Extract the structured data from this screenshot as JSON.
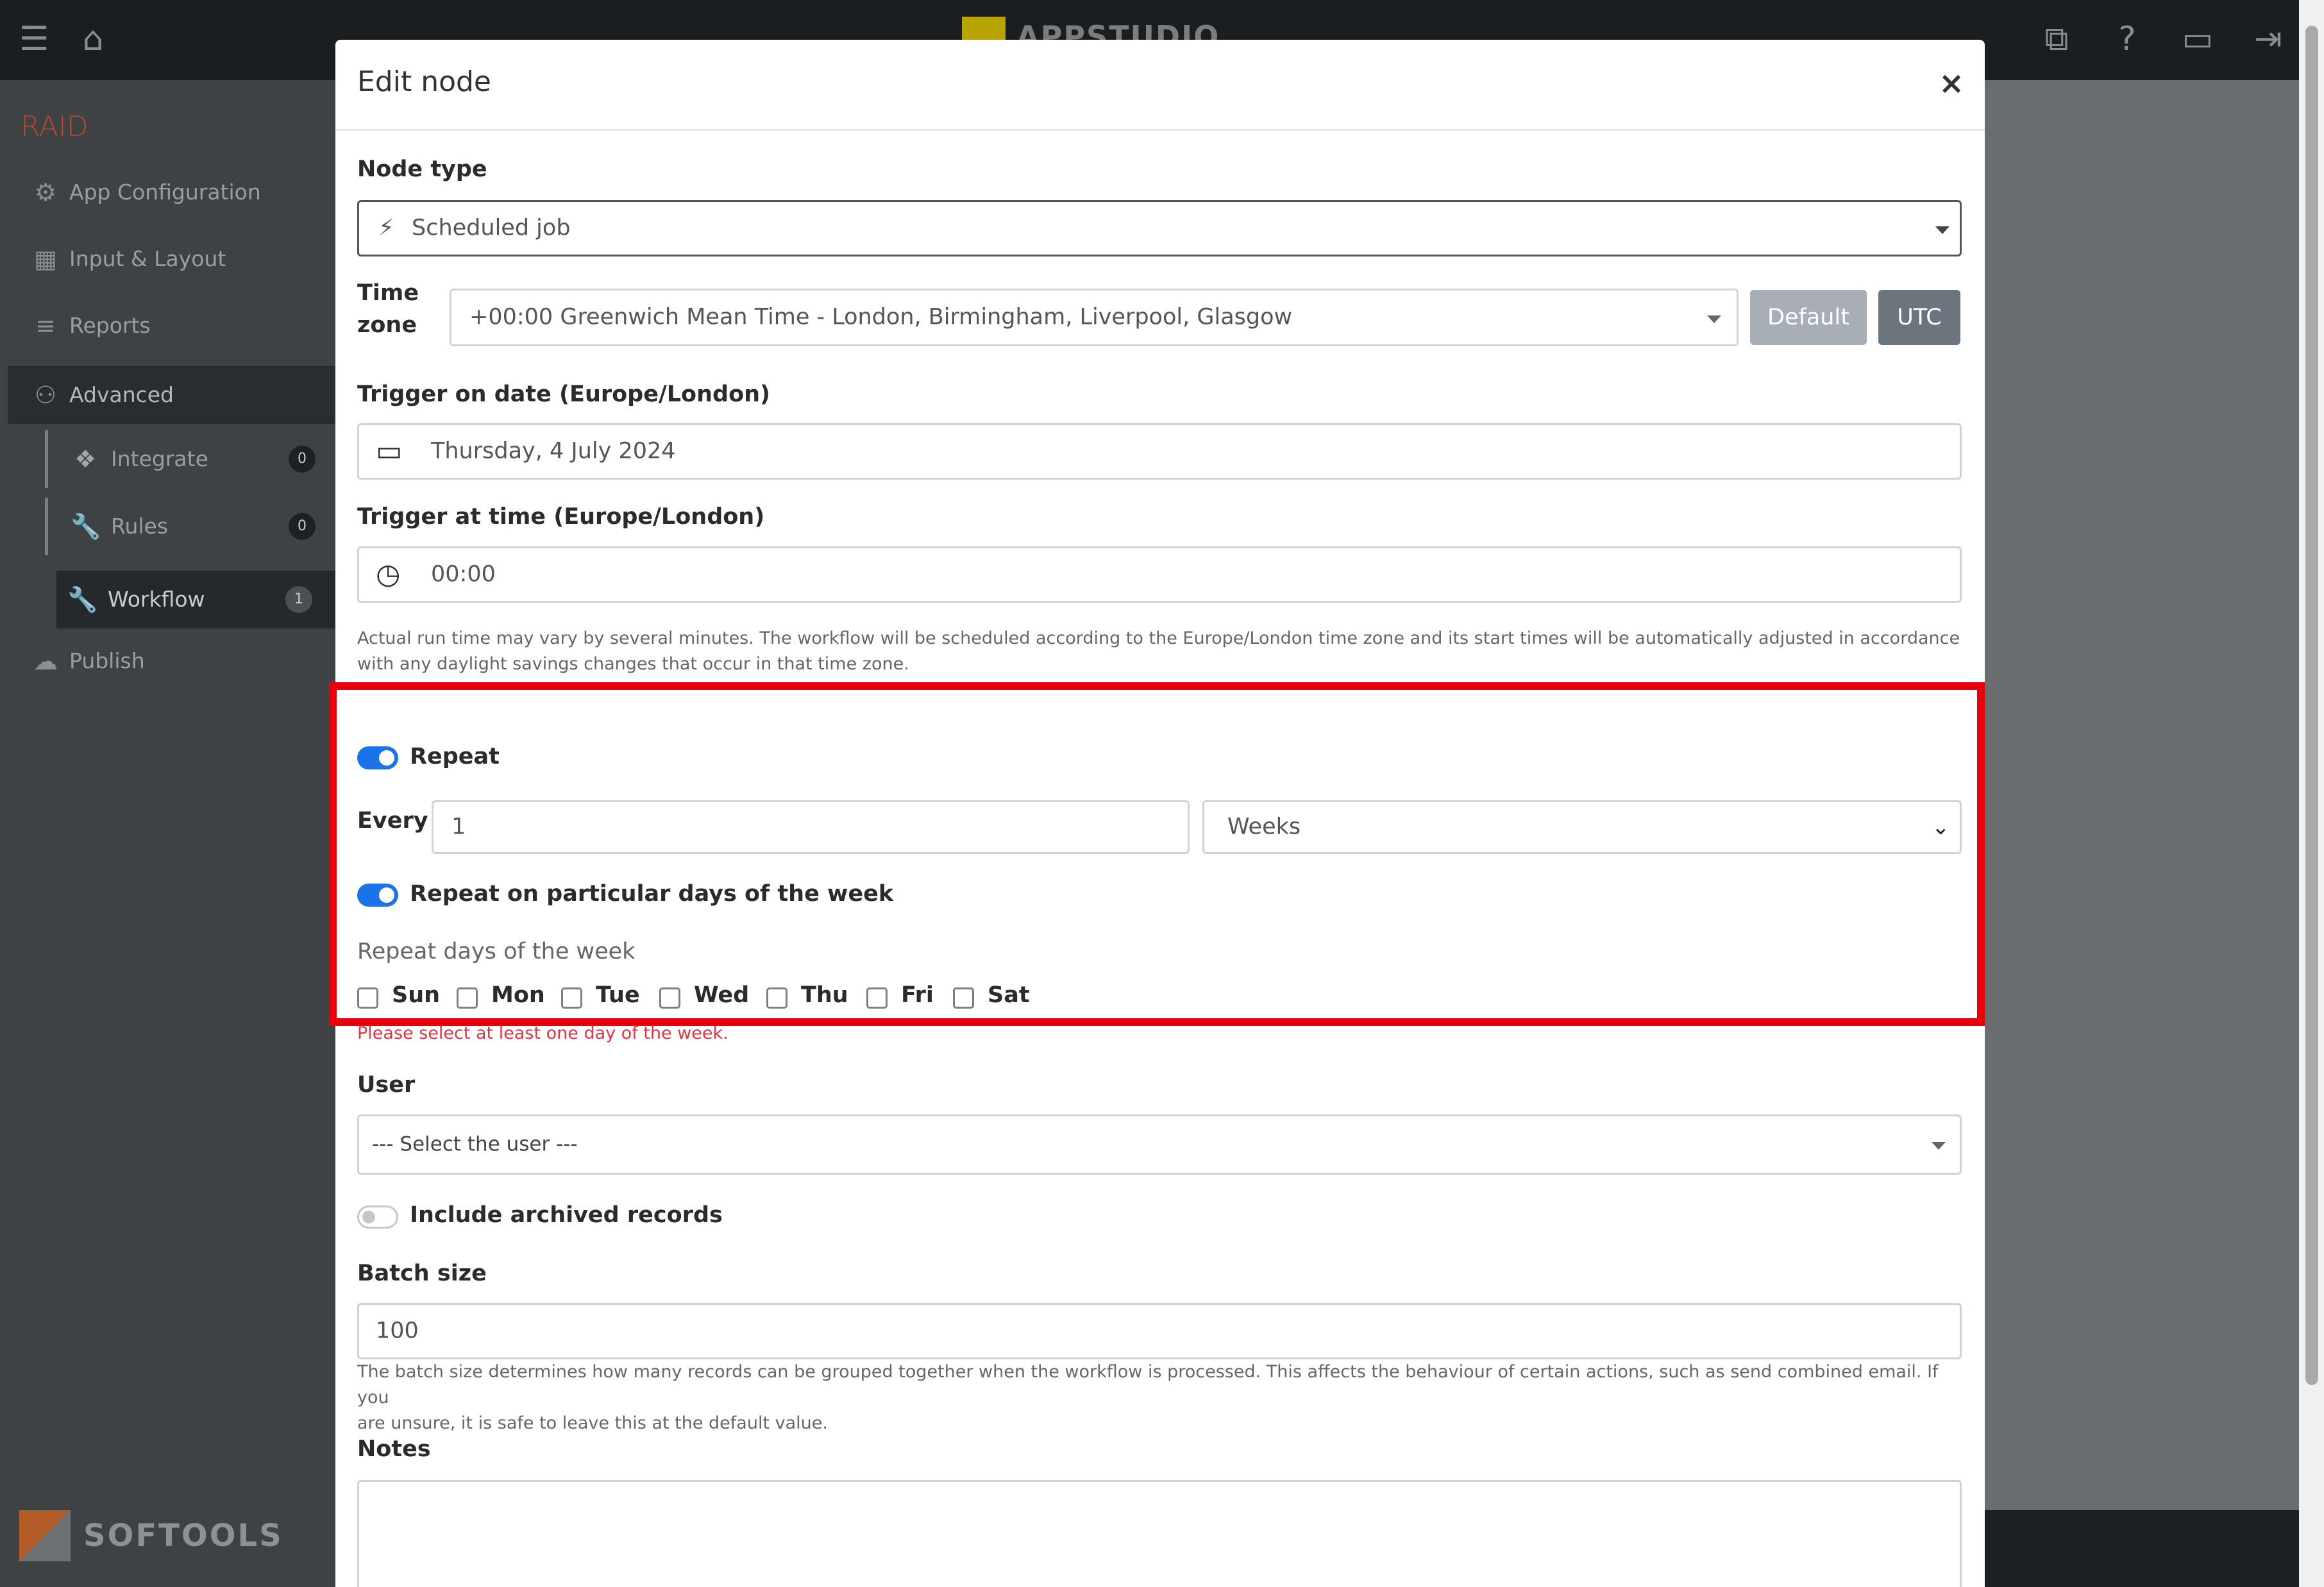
{
  "topbar": {
    "app_name": "APPSTUDIO",
    "icons": [
      "menu-icon",
      "home-icon",
      "copy-icon",
      "help-icon",
      "video-icon",
      "logout-icon"
    ]
  },
  "sidebar": {
    "title": "RAID",
    "items": [
      {
        "label": "App Configuration",
        "icon": "gear-icon"
      },
      {
        "label": "Input & Layout",
        "icon": "layout-icon"
      },
      {
        "label": "Reports",
        "icon": "chart-icon"
      },
      {
        "label": "Advanced",
        "icon": "advanced-icon"
      },
      {
        "label": "Integrate",
        "icon": "cubes-icon",
        "badge": "0"
      },
      {
        "label": "Rules",
        "icon": "wrench-icon",
        "badge": "0"
      },
      {
        "label": "Workflow",
        "icon": "wrench-icon",
        "badge": "1"
      },
      {
        "label": "Publish",
        "icon": "cloud-icon"
      }
    ],
    "brand": "SOFTOOLS"
  },
  "modal": {
    "title": "Edit node",
    "close": "×",
    "node_type_label": "Node type",
    "node_type_value": "Scheduled job",
    "timezone_label_1": "Time",
    "timezone_label_2": "zone",
    "timezone_value": "+00:00 Greenwich Mean Time - London, Birmingham, Liverpool, Glasgow",
    "default_btn": "Default",
    "utc_btn": "UTC",
    "trigger_date_label": "Trigger on date (Europe/London)",
    "trigger_date_value": "Thursday, 4 July 2024",
    "trigger_time_label": "Trigger at time (Europe/London)",
    "trigger_time_value": "00:00",
    "run_time_help_1": "Actual run time may vary by several minutes. The workflow will be scheduled according to the Europe/London time zone and its start times will be automatically adjusted in accordance",
    "run_time_help_2": "with any daylight savings changes that occur in that time zone.",
    "repeat_label": "Repeat",
    "every_label": "Every",
    "every_value": "1",
    "every_unit": "Weeks",
    "repeat_days_toggle_label": "Repeat on particular days of the week",
    "repeat_days_label": "Repeat days of the week",
    "days": [
      "Sun",
      "Mon",
      "Tue",
      "Wed",
      "Thu",
      "Fri",
      "Sat"
    ],
    "days_error": "Please select at least one day of the week.",
    "user_label": "User",
    "user_placeholder": "--- Select the user ---",
    "archived_label": "Include archived records",
    "batch_label": "Batch size",
    "batch_value": "100",
    "batch_help_1": "The batch size determines how many records can be grouped together when the workflow is processed. This affects the behaviour of certain actions, such as send combined email. If you",
    "batch_help_2": "are unsure, it is safe to leave this at the default value.",
    "notes_label": "Notes"
  }
}
